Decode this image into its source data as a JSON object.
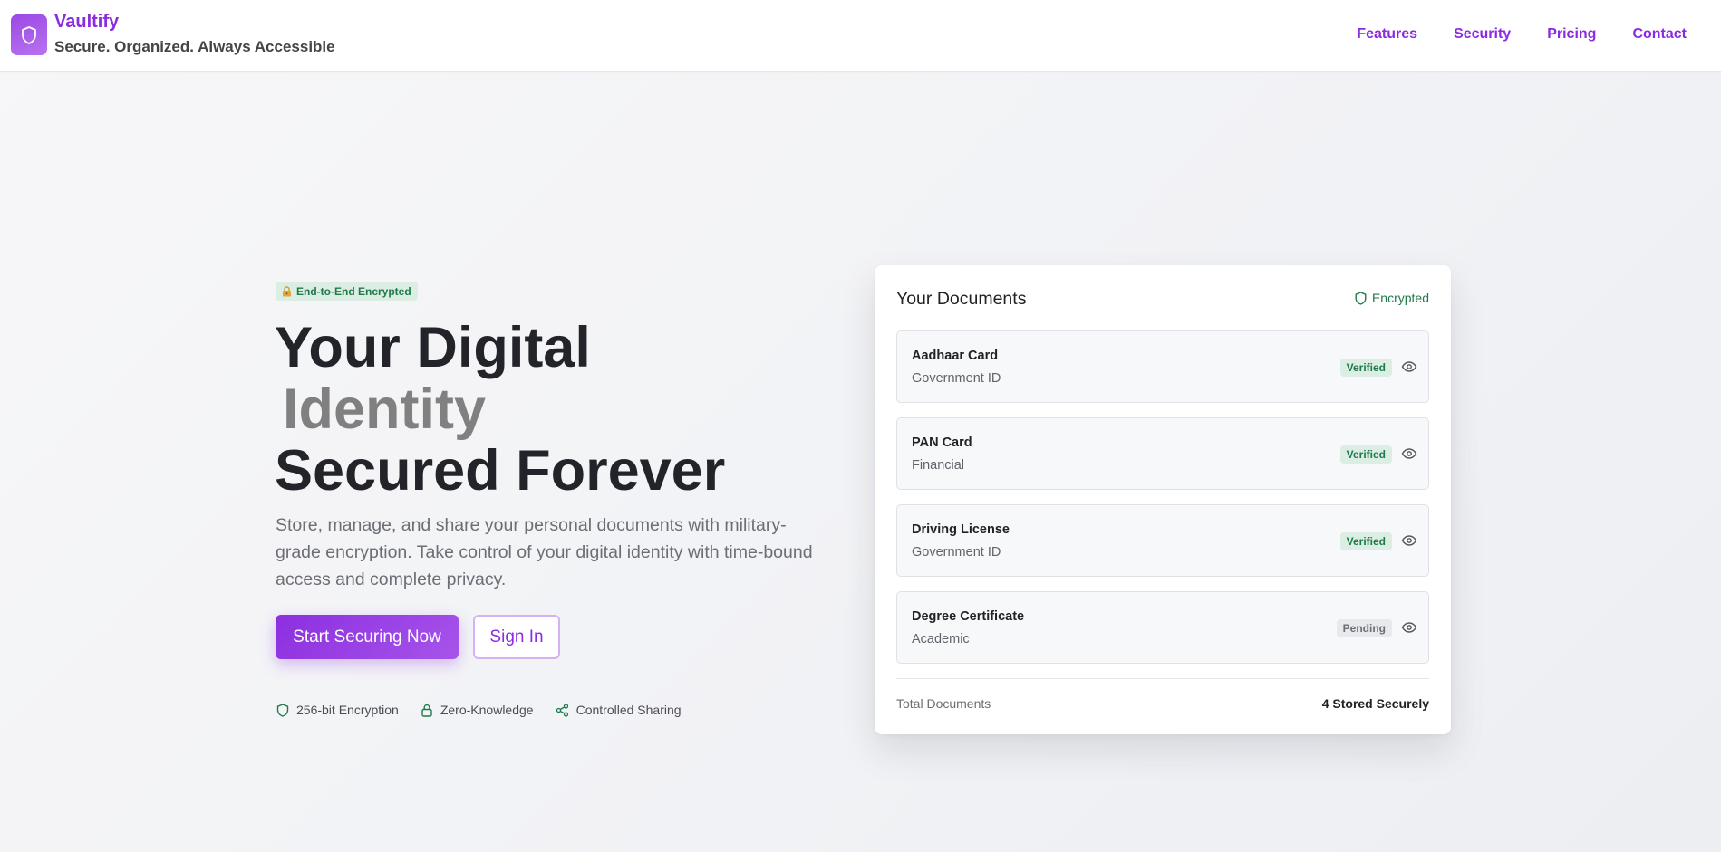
{
  "header": {
    "brand_name": "Vaultify",
    "brand_tagline": "Secure. Organized. Always Accessible",
    "nav": [
      {
        "label": "Features"
      },
      {
        "label": "Security"
      },
      {
        "label": "Pricing"
      },
      {
        "label": "Contact"
      }
    ]
  },
  "hero": {
    "badge": "End-to-End Encrypted",
    "title_line1": "Your Digital",
    "title_line2": "Identity",
    "title_line3": "Secured Forever",
    "description": "Store, manage, and share your personal documents with military-grade encryption. Take control of your digital identity with time-bound access and complete privacy.",
    "primary_cta": "Start Securing Now",
    "secondary_cta": "Sign In",
    "features": [
      {
        "label": "256-bit Encryption",
        "icon": "shield-icon"
      },
      {
        "label": "Zero-Knowledge",
        "icon": "lock-icon"
      },
      {
        "label": "Controlled Sharing",
        "icon": "share-icon"
      }
    ]
  },
  "card": {
    "title": "Your Documents",
    "status": "Encrypted",
    "documents": [
      {
        "name": "Aadhaar Card",
        "type": "Government ID",
        "status": "Verified"
      },
      {
        "name": "PAN Card",
        "type": "Financial",
        "status": "Verified"
      },
      {
        "name": "Driving License",
        "type": "Government ID",
        "status": "Verified"
      },
      {
        "name": "Degree Certificate",
        "type": "Academic",
        "status": "Pending"
      }
    ],
    "footer_label": "Total Documents",
    "footer_value": "4 Stored Securely"
  },
  "colors": {
    "brand": "#8a2be2",
    "success": "#1f7a4a",
    "success_bg": "#dcede4",
    "pending_bg": "#e8e9ec"
  }
}
